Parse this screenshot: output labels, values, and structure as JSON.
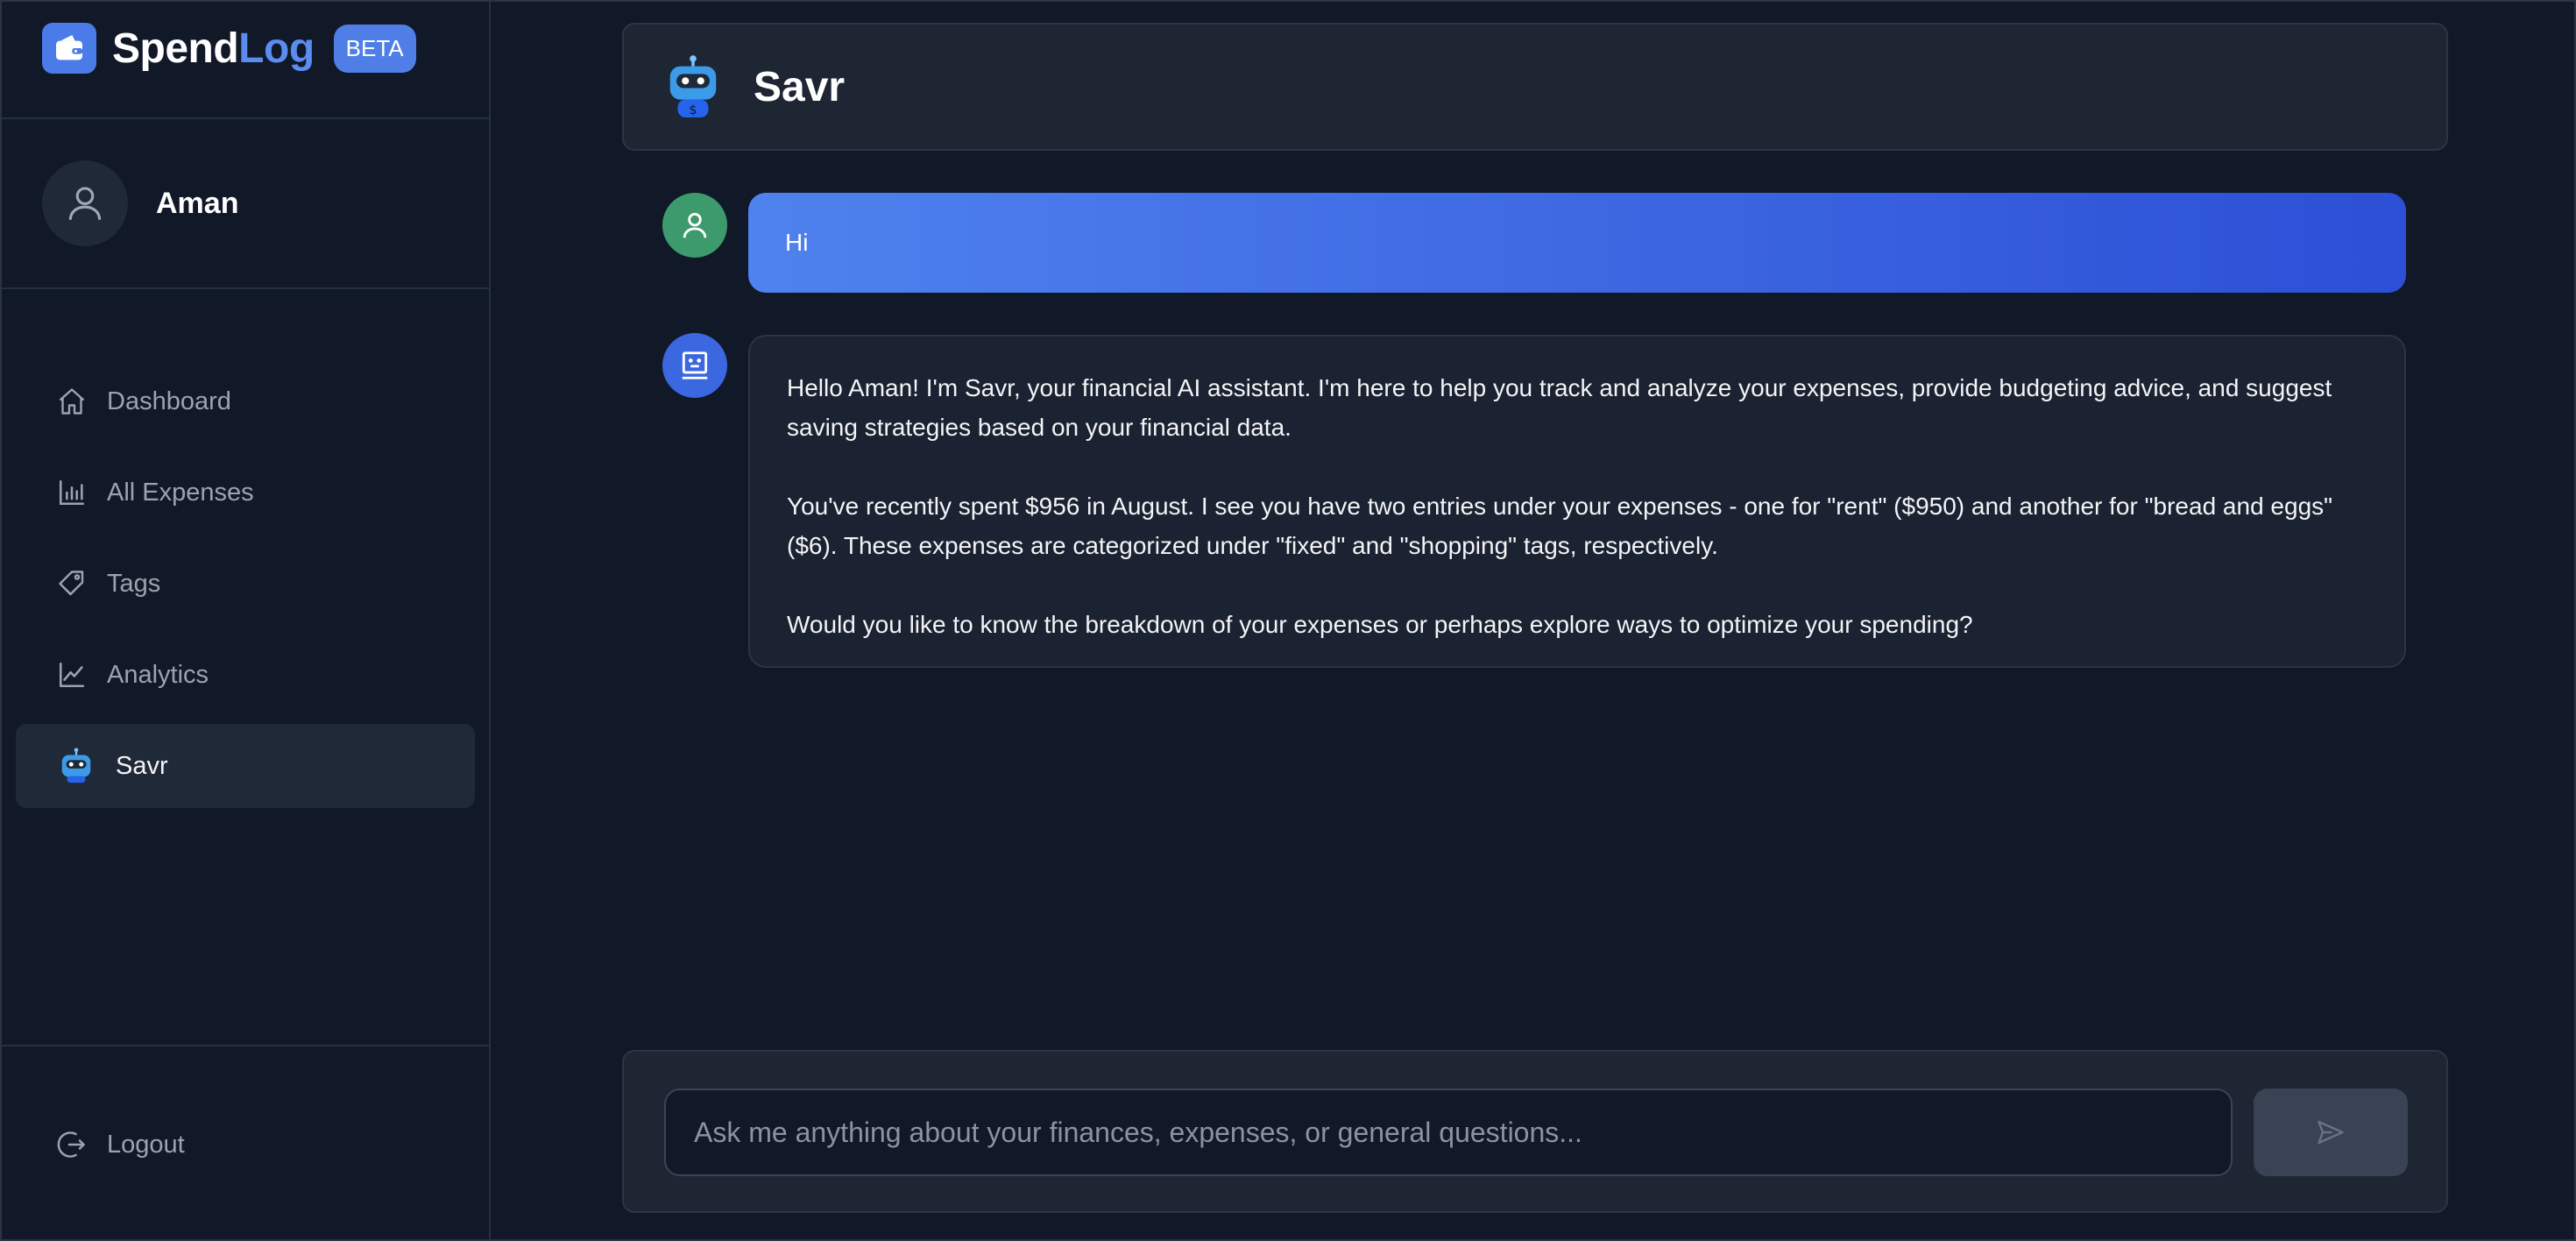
{
  "brand": {
    "name_a": "Spend",
    "name_b": "Log",
    "badge": "BETA"
  },
  "user": {
    "name": "Aman"
  },
  "nav": [
    {
      "label": "Dashboard",
      "icon": "home-icon"
    },
    {
      "label": "All Expenses",
      "icon": "bar-chart-icon"
    },
    {
      "label": "Tags",
      "icon": "tag-icon"
    },
    {
      "label": "Analytics",
      "icon": "line-chart-icon"
    },
    {
      "label": "Savr",
      "icon": "robot-icon",
      "active": true
    }
  ],
  "logout": {
    "label": "Logout",
    "icon": "logout-icon"
  },
  "chat": {
    "title": "Savr",
    "messages": [
      {
        "role": "user",
        "text": "Hi"
      },
      {
        "role": "assistant",
        "paragraphs": [
          "Hello Aman! I'm Savr, your financial AI assistant. I'm here to help you track and analyze your expenses, provide budgeting advice, and suggest saving strategies based on your financial data.",
          "You've recently spent $956 in August. I see you have two entries under your expenses - one for \"rent\" ($950) and another for \"bread and eggs\" ($6). These expenses are categorized under \"fixed\" and \"shopping\" tags, respectively.",
          "Would you like to know the breakdown of your expenses or perhaps explore ways to optimize your spending?"
        ]
      }
    ],
    "input": {
      "value": "",
      "placeholder": "Ask me anything about your finances, expenses, or general questions..."
    },
    "send_icon": "send-icon"
  },
  "colors": {
    "accent": "#4f7fe6",
    "background": "#111827",
    "panel": "#1e2533",
    "user_avatar": "#3d9a6c"
  }
}
